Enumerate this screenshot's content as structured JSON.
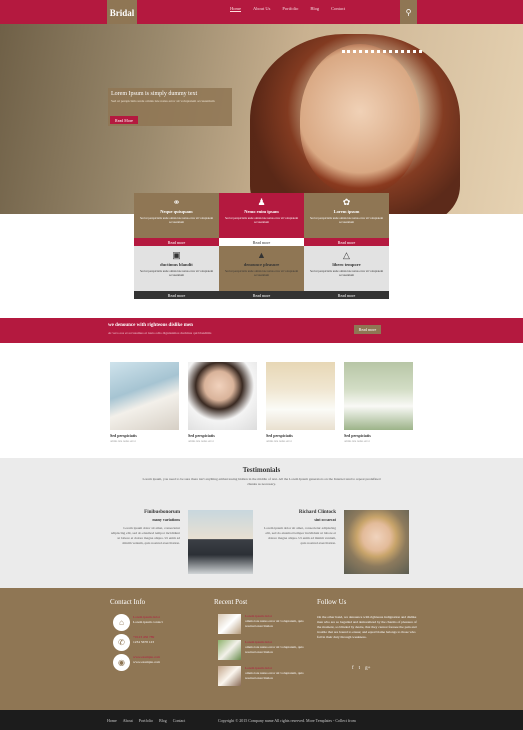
{
  "header": {
    "logo": "Bridal",
    "nav": [
      "Home",
      "About Us",
      "Portfolio",
      "Blog",
      "Contact"
    ],
    "search_icon": "search-icon"
  },
  "hero": {
    "title": "Lorem Ipsum is simply dummy text",
    "text": "Sed ut perspiciatis unde omnis iste natus error sit voluptatem accusantium",
    "button": "Read More"
  },
  "features": [
    {
      "icon": "rings-icon",
      "title": "Neque quisquam",
      "text": "Sed ut perspiciatis unde omnis iste natus error sit voluptatem accusantium",
      "more": "Read more"
    },
    {
      "icon": "couple-icon",
      "title": "Nemo enim ipsam",
      "text": "Sed ut perspiciatis unde omnis iste natus error sit voluptatem accusantium",
      "more": "Read more"
    },
    {
      "icon": "bouquet-icon",
      "title": "Lorem ipsum",
      "text": "Sed ut perspiciatis unde omnis iste natus error sit voluptatem accusantium",
      "more": "Read more"
    },
    {
      "icon": "gift-icon",
      "title": "ductimus blandit",
      "text": "Sed ut perspiciatis unde omnis iste natus error sit voluptatem accusantium",
      "more": "Read more"
    },
    {
      "icon": "cake-icon",
      "title": "denounce pleasure",
      "text": "Sed ut perspiciatis unde omnis iste natus error sit voluptatem accusantium",
      "more": "Read more"
    },
    {
      "icon": "dress-icon",
      "title": "libero tempore",
      "text": "Sed ut perspiciatis unde omnis iste natus error sit voluptatem accusantium",
      "more": "Read more"
    }
  ],
  "banner": {
    "title": "we denounce with righteous dislike men",
    "text": "At vero eos et accusamus et iusto odio dignissimos ducimus qui blanditiis",
    "button": "Read more"
  },
  "gallery": [
    {
      "title": "Sed perspiciatis",
      "text": "omnis iste natus error"
    },
    {
      "title": "Sed perspiciatis",
      "text": "omnis iste natus error"
    },
    {
      "title": "Sed perspiciatis",
      "text": "omnis iste natus error"
    },
    {
      "title": "Sed perspiciatis",
      "text": "omnis iste natus error"
    }
  ],
  "testimonials": {
    "title": "Testimonials",
    "text": "Lorem ipsum, you need to be sure there isn't anything embarrassing hidden in the middle of text. All the Lorem Ipsum generators on the Internet tend to repeat predefined chunks as necessary.",
    "items": [
      {
        "name": "Finibusbonorum",
        "sub": "many variations",
        "text": "Lorem ipsum dolor sit amet, consectetur adipiscing elit, sed do eiusmod tempor incididunt ut labore et dolore magna aliqua. Ut enim ad minim veniam, quis nostrud exercitation."
      },
      {
        "name": "Richard Clintock",
        "sub": "sint occaecat",
        "text": "Lorem ipsum dolor sit amet, consectetur adipiscing elit, sed do eiusmod tempor incididunt ut labore et dolore magna aliqua. Ut enim ad minim veniam, quis nostrud exercitation."
      }
    ]
  },
  "footer": {
    "contact_title": "Contact Info",
    "contact": [
      {
        "icon": "home-icon",
        "l1": "Lorem ipsum dolor",
        "l2": "Lorem ipsum contact"
      },
      {
        "icon": "phone-icon",
        "l1": "+0123 456 789",
        "l2": "1234 5678 123"
      },
      {
        "icon": "globe-icon",
        "l1": "www.example.com",
        "l2": "www.example.com"
      }
    ],
    "recent_title": "Recent Post",
    "posts": [
      {
        "title": "Lorem ipsum dolor",
        "text": "omnis iste natus error sit voluptatem, quis nostrud exercitation"
      },
      {
        "title": "Lorem ipsum dolor",
        "text": "omnis iste natus error sit voluptatem, quis nostrud exercitation"
      },
      {
        "title": "Lorem ipsum dolor",
        "text": "omnis iste natus error sit voluptatem, quis nostrud exercitation"
      }
    ],
    "follow_title": "Follow Us",
    "follow_text": "On the other hand, we denounce with righteous indignation and dislike men who are so beguiled and demoralized by the charms of pleasure of the moment, so blinded by desire, that they cannot foresee the pain and trouble that are bound to ensue; and equal blame belongs to those who fail in their duty through weakness.",
    "social": [
      "f",
      "t",
      "g+"
    ]
  },
  "bottom": {
    "nav": [
      "Home",
      "About",
      "Portfolio",
      "Blog",
      "Contact"
    ],
    "copyright": "Copyright © 2015 Company name All rights reserved.",
    "templates": "More Templates",
    "collect": "- Collect from"
  },
  "colors": {
    "brand_red": "#b4193f",
    "brand_tan": "#8f7654",
    "dark": "#1c1c1c"
  }
}
